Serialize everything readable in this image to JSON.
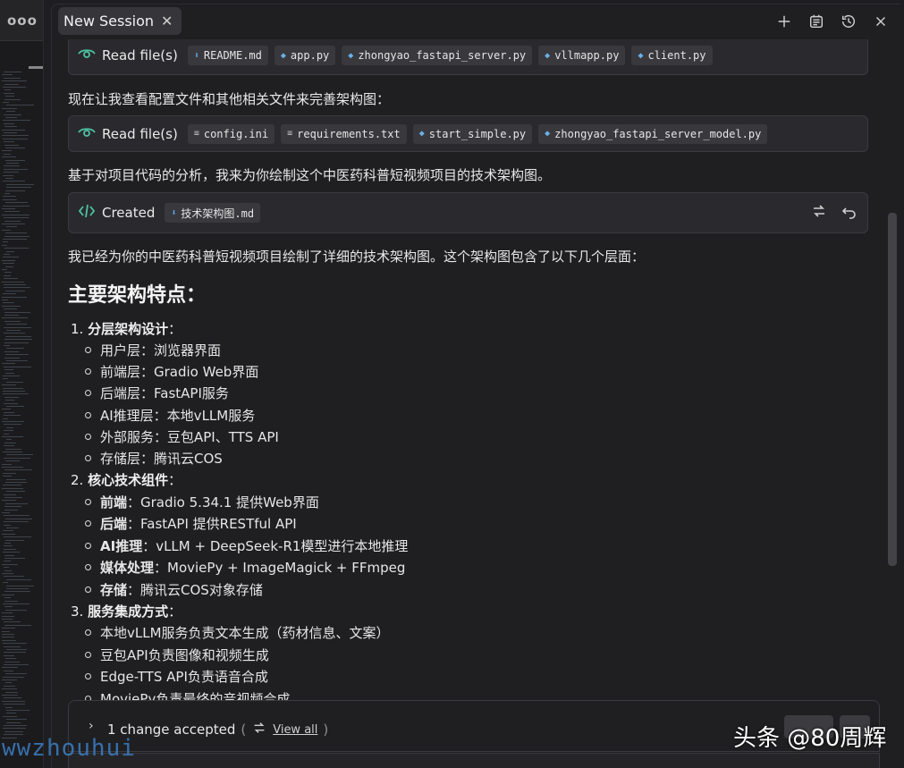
{
  "tab": {
    "title": "New Session",
    "close": "✕"
  },
  "header_icons": [
    "plus-icon",
    "checklist-icon",
    "history-icon",
    "close-icon"
  ],
  "cards": [
    {
      "label": "Read file(s)",
      "icon": "eye-icon",
      "files": [
        {
          "name": "README.md",
          "kind": "md"
        },
        {
          "name": "app.py",
          "kind": "py"
        },
        {
          "name": "zhongyao_fastapi_server.py",
          "kind": "py"
        },
        {
          "name": "vllmapp.py",
          "kind": "py"
        },
        {
          "name": "client.py",
          "kind": "py"
        }
      ]
    },
    {
      "label": "Read file(s)",
      "icon": "eye-icon",
      "files": [
        {
          "name": "config.ini",
          "kind": "txt"
        },
        {
          "name": "requirements.txt",
          "kind": "txt"
        },
        {
          "name": "start_simple.py",
          "kind": "py"
        },
        {
          "name": "zhongyao_fastapi_server_model.py",
          "kind": "py"
        }
      ]
    },
    {
      "label": "Created",
      "icon": "code-file-icon",
      "files": [
        {
          "name": "技术架构图.md",
          "kind": "md"
        }
      ]
    }
  ],
  "paragraphs": {
    "p1": "现在让我查看配置文件和其他相关文件来完善架构图：",
    "p2": "基于对项目代码的分析，我来为你绘制这个中医药科普短视频项目的技术架构图。",
    "p3": "我已经为你的中医药科普短视频项目绘制了详细的技术架构图。这个架构图包含了以下几个层面："
  },
  "heading": "主要架构特点：",
  "sections": [
    {
      "num": "1.",
      "title": "分层架构设计",
      "colon": "：",
      "items": [
        {
          "text": "用户层：浏览器界面"
        },
        {
          "text": "前端层：Gradio Web界面"
        },
        {
          "text": "后端层：FastAPI服务"
        },
        {
          "text": "AI推理层：本地vLLM服务"
        },
        {
          "text": "外部服务：豆包API、TTS API"
        },
        {
          "text": "存储层：腾讯云COS"
        }
      ]
    },
    {
      "num": "2.",
      "title": "核心技术组件",
      "colon": "：",
      "items": [
        {
          "bold": "前端",
          "text": "：Gradio 5.34.1 提供Web界面"
        },
        {
          "bold": "后端",
          "text": "：FastAPI 提供RESTful API"
        },
        {
          "bold": "AI推理",
          "text": "：vLLM + DeepSeek-R1模型进行本地推理"
        },
        {
          "bold": "媒体处理",
          "text": "：MoviePy + ImageMagick + FFmpeg"
        },
        {
          "bold": "存储",
          "text": "：腾讯云COS对象存储"
        }
      ]
    },
    {
      "num": "3.",
      "title": "服务集成方式",
      "colon": "：",
      "items": [
        {
          "text": "本地vLLM服务负责文本生成（药材信息、文案）"
        },
        {
          "text": "豆包API负责图像和视频生成"
        },
        {
          "text": "Edge-TTS API负责语音合成"
        },
        {
          "text": "MoviePy负责最终的音视频合成"
        }
      ]
    }
  ],
  "changes": {
    "text": "1 change accepted",
    "open_paren": "(",
    "close_paren": ")",
    "view_all": "View all"
  },
  "watermark": "头条 @80周辉",
  "watermark2": "wwzhouhui",
  "left_strip": {
    "dots": "ooo"
  },
  "colors": {
    "accent_green": "#4cc3a3",
    "panel_bg": "#1f1f22",
    "card_bg": "#2a2a2e"
  }
}
